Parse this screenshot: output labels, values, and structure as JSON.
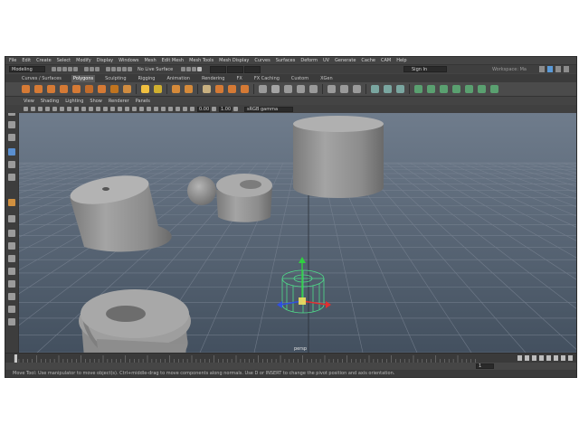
{
  "menus": [
    "File",
    "Edit",
    "Create",
    "Select",
    "Modify",
    "Display",
    "Windows",
    "Mesh",
    "Edit Mesh",
    "Mesh Tools",
    "Mesh Display",
    "Curves",
    "Surfaces",
    "Deform",
    "UV",
    "Generate",
    "Cache",
    "CAM",
    "Help"
  ],
  "statusline": {
    "mode": "Modeling",
    "live_surface": "No Live Surface",
    "sign_in": "Sign In",
    "workspace": "Workspace: Ma"
  },
  "shelf_tabs": [
    "Curves / Surfaces",
    "Polygons",
    "Sculpting",
    "Rigging",
    "Animation",
    "Rendering",
    "FX",
    "FX Caching",
    "Custom",
    "XGen"
  ],
  "shelf_active": "Polygons",
  "panel_menus": [
    "View",
    "Shading",
    "Lighting",
    "Show",
    "Renderer",
    "Panels"
  ],
  "view_fields": {
    "exposure": "0.00",
    "gamma": "1.00",
    "color_space": "sRGB gamma"
  },
  "viewport_label": "persp",
  "frame_current": "1",
  "help_text": "Move Tool: Use manipulator to move object(s). Ctrl+middle-drag to move components along normals. Use D or INSERT to change the pivot position and axis orientation.",
  "colors": {
    "viewport_top": "#6f7c8c",
    "viewport_bottom": "#43505f",
    "grid": "#7a8493",
    "mesh": "#9a9a9a",
    "selection_wire": "#4fdc8a",
    "axis_x": "#e03030",
    "axis_y": "#30d040",
    "axis_z": "#3050e0"
  }
}
